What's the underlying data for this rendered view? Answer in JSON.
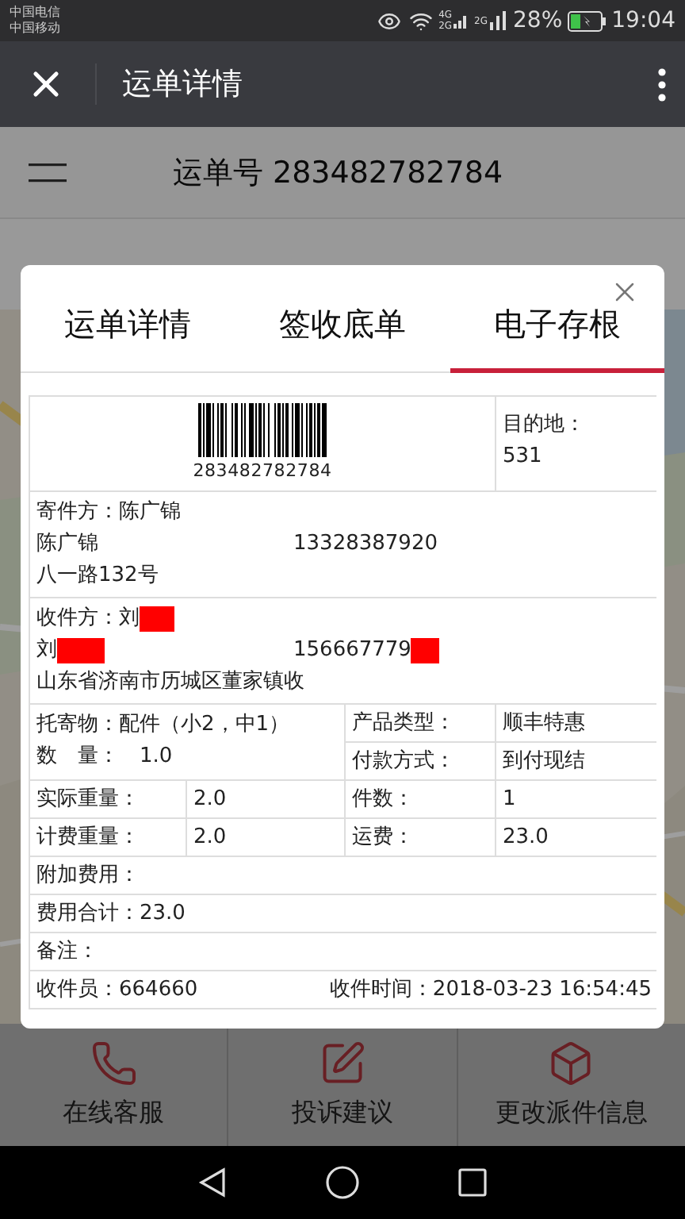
{
  "status_bar": {
    "carriers": [
      "中国电信",
      "中国移动"
    ],
    "signal_labels": [
      "4G",
      "2G",
      "2G"
    ],
    "battery": "28%",
    "time": "19:04"
  },
  "app_bar": {
    "title": "运单详情"
  },
  "waybill_header": {
    "text": "运单号 283482782784"
  },
  "dialog": {
    "tabs": [
      {
        "label": "运单详情",
        "selected": false
      },
      {
        "label": "签收底单",
        "selected": false
      },
      {
        "label": "电子存根",
        "selected": true
      }
    ],
    "barcode": "283482782784",
    "destination": {
      "label": "目的地：",
      "value": "531"
    },
    "sender": {
      "title": "寄件方：陈广锦",
      "name": "陈广锦",
      "phone": "13328387920",
      "address": "八一路132号"
    },
    "recipient": {
      "title": "收件方：刘",
      "name": "刘",
      "phone": "156667779",
      "address": "山东省济南市历城区董家镇收",
      "redacted": true
    },
    "goods": {
      "item": "托寄物：配件（小2，中1）",
      "quantity": "数　量：　1.0"
    },
    "product_rows": [
      {
        "label": "产品类型：",
        "value": "顺丰特惠"
      },
      {
        "label": "付款方式：",
        "value": "到付现结"
      }
    ],
    "weight_rows": [
      {
        "label": "实际重量：",
        "value": "2.0",
        "label_2": "件数：",
        "value_2": "1"
      },
      {
        "label": "计费重量：",
        "value": "2.0",
        "label_2": "运费：",
        "value_2": "23.0"
      }
    ],
    "full_rows": [
      "附加费用：",
      "费用合计：23.0",
      "备注："
    ],
    "footer": {
      "collector": "收件员：664660",
      "time": "收件时间：2018-03-23 16:54:45"
    }
  },
  "bottom_actions": [
    {
      "kind": "phone",
      "label": "在线客服"
    },
    {
      "kind": "edit",
      "label": "投诉建议"
    },
    {
      "kind": "box",
      "label": "更改派件信息"
    }
  ]
}
